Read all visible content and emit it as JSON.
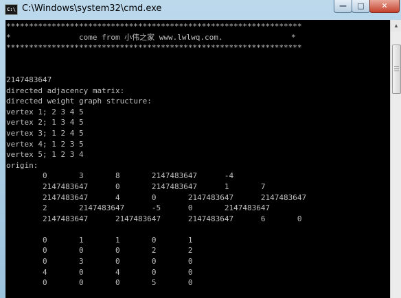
{
  "window": {
    "title": "C:\\Windows\\system32\\cmd.exe",
    "icon_label": "C:\\",
    "buttons": {
      "minimize": "—",
      "maximize": "□",
      "close": "✕"
    }
  },
  "console": {
    "text": "*****************************************************************\n*               come from 小伟之家 www.lwlwq.com.               *\n*****************************************************************\n\n\n2147483647\ndirected adjacency matrix:\ndirected weight graph structure:\nvertex 1; 2 3 4 5\nvertex 2; 1 3 4 5\nvertex 3; 1 2 4 5\nvertex 4; 1 2 3 5\nvertex 5; 1 2 3 4\norigin:\n        0       3       8       2147483647      -4\n        2147483647      0       2147483647      1       7\n        2147483647      4       0       2147483647      2147483647\n        2       2147483647      -5      0       2147483647\n        2147483647      2147483647      2147483647      6       0\n\n        0       1       1       0       1\n        0       0       0       2       2\n        0       3       0       0       0\n        4       0       4       0       0\n        0       0       0       5       0"
  },
  "scrollbar": {
    "up_arrow": "▲"
  }
}
